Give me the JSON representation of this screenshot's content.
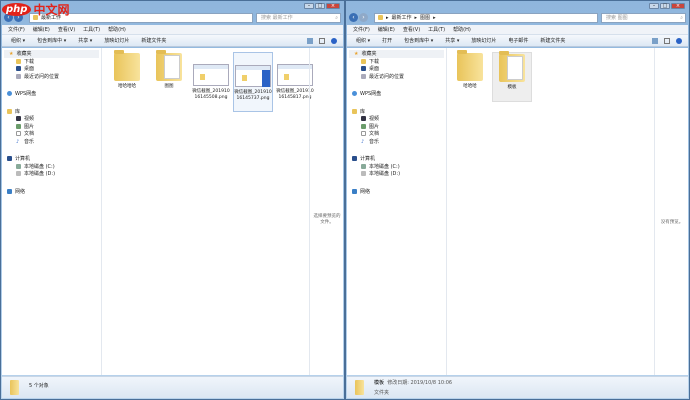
{
  "logo": {
    "text": "php中文网",
    "php": "php",
    "cn": "中文网"
  },
  "menu": [
    "文件(F)",
    "编辑(E)",
    "查看(V)",
    "工具(T)",
    "帮助(H)"
  ],
  "sidebar": {
    "favorites": "收藏夹",
    "fav_items": [
      "下载",
      "桌面",
      "最近访问的位置"
    ],
    "wps": "WPS网盘",
    "library": "库",
    "lib_items": [
      "视频",
      "图片",
      "文档",
      "音乐"
    ],
    "computer": "计算机",
    "drives": [
      "本地磁盘 (C:)",
      "本地磁盘 (D:)"
    ],
    "network": "网络"
  },
  "left": {
    "path": "最新工作",
    "search": "搜索 最新工作",
    "toolbar": [
      "组织 ▾",
      "包含到库中 ▾",
      "共享 ▾",
      "放映幻灯片",
      "新建文件夹"
    ],
    "items": [
      {
        "name": "哈哈哈哈",
        "type": "folder"
      },
      {
        "name": "图图",
        "type": "folder"
      },
      {
        "name": "微信截图_20191016145508.png",
        "type": "image"
      },
      {
        "name": "微信截图_20191016145737.png",
        "type": "image"
      },
      {
        "name": "微信截图_20191016145817.png",
        "type": "image"
      }
    ],
    "preview": "选择要预览的文件。",
    "status": "5 个对象"
  },
  "right": {
    "path": [
      "最新工作",
      "图图"
    ],
    "search": "搜索 图图",
    "toolbar": [
      "组织 ▾",
      "打开",
      "包含到库中 ▾",
      "共享 ▾",
      "放映幻灯片",
      "电子邮件",
      "新建文件夹"
    ],
    "items": [
      {
        "name": "哈哈哈",
        "type": "folder"
      },
      {
        "name": "模板",
        "type": "folder"
      }
    ],
    "preview": "没有预览。",
    "status": {
      "name": "模板",
      "modified": "修改日期: 2019/10/8 10:06",
      "kind": "文件夹"
    }
  }
}
